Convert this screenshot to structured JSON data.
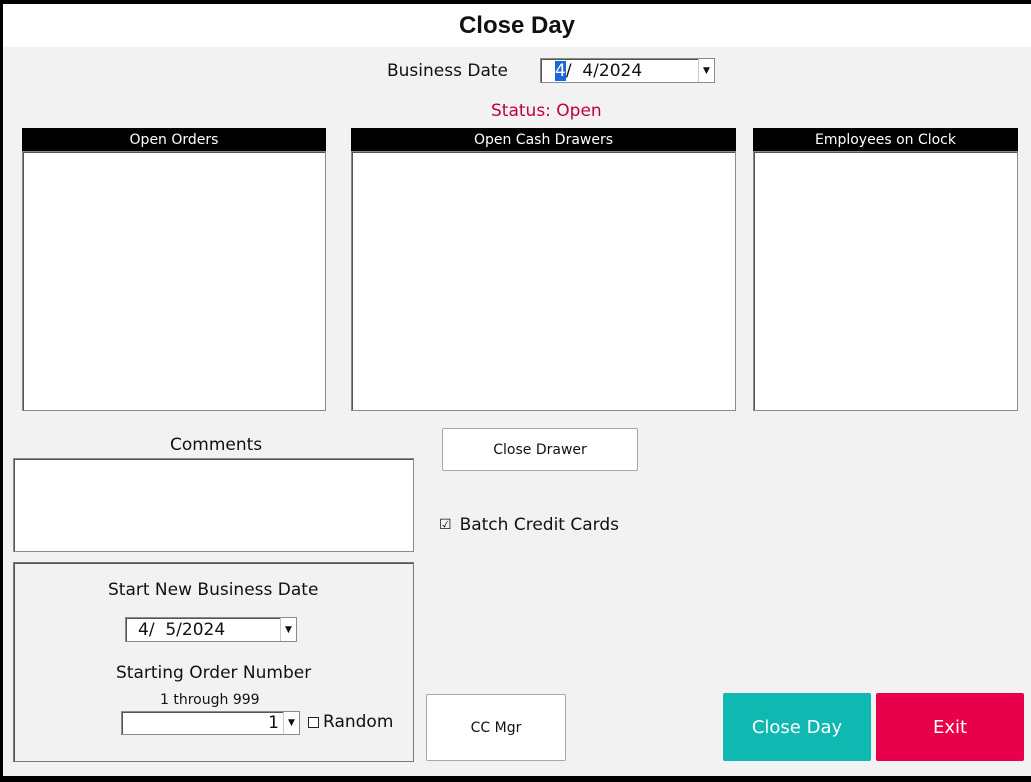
{
  "window": {
    "title": "Close Day"
  },
  "business_date": {
    "label": "Business Date",
    "month_selected": "4",
    "value_rest": "/  4/2024"
  },
  "status": {
    "text": "Status: Open",
    "color": "#c0003c"
  },
  "panels": {
    "open_orders": "Open Orders",
    "open_cash_drawers": "Open Cash Drawers",
    "employees_on_clock": "Employees on Clock"
  },
  "buttons": {
    "close_drawer": "Close Drawer",
    "cc_mgr": "CC Mgr",
    "close_day": "Close Day",
    "exit": "Exit"
  },
  "batch_credit_cards": {
    "label": "Batch Credit Cards",
    "checked": true,
    "mark": "☑"
  },
  "comments": {
    "label": "Comments",
    "value": ""
  },
  "new_business_date": {
    "label": "Start New Business Date",
    "value": "4/  5/2024"
  },
  "starting_order": {
    "label": "Starting Order Number",
    "range": "1 through 999",
    "value": "1",
    "random_label": "Random",
    "random_checked": false
  },
  "colors": {
    "close_day": "#0fb8b0",
    "exit": "#e8004c"
  },
  "icons": {
    "dropdown": "chevron-down-icon"
  }
}
